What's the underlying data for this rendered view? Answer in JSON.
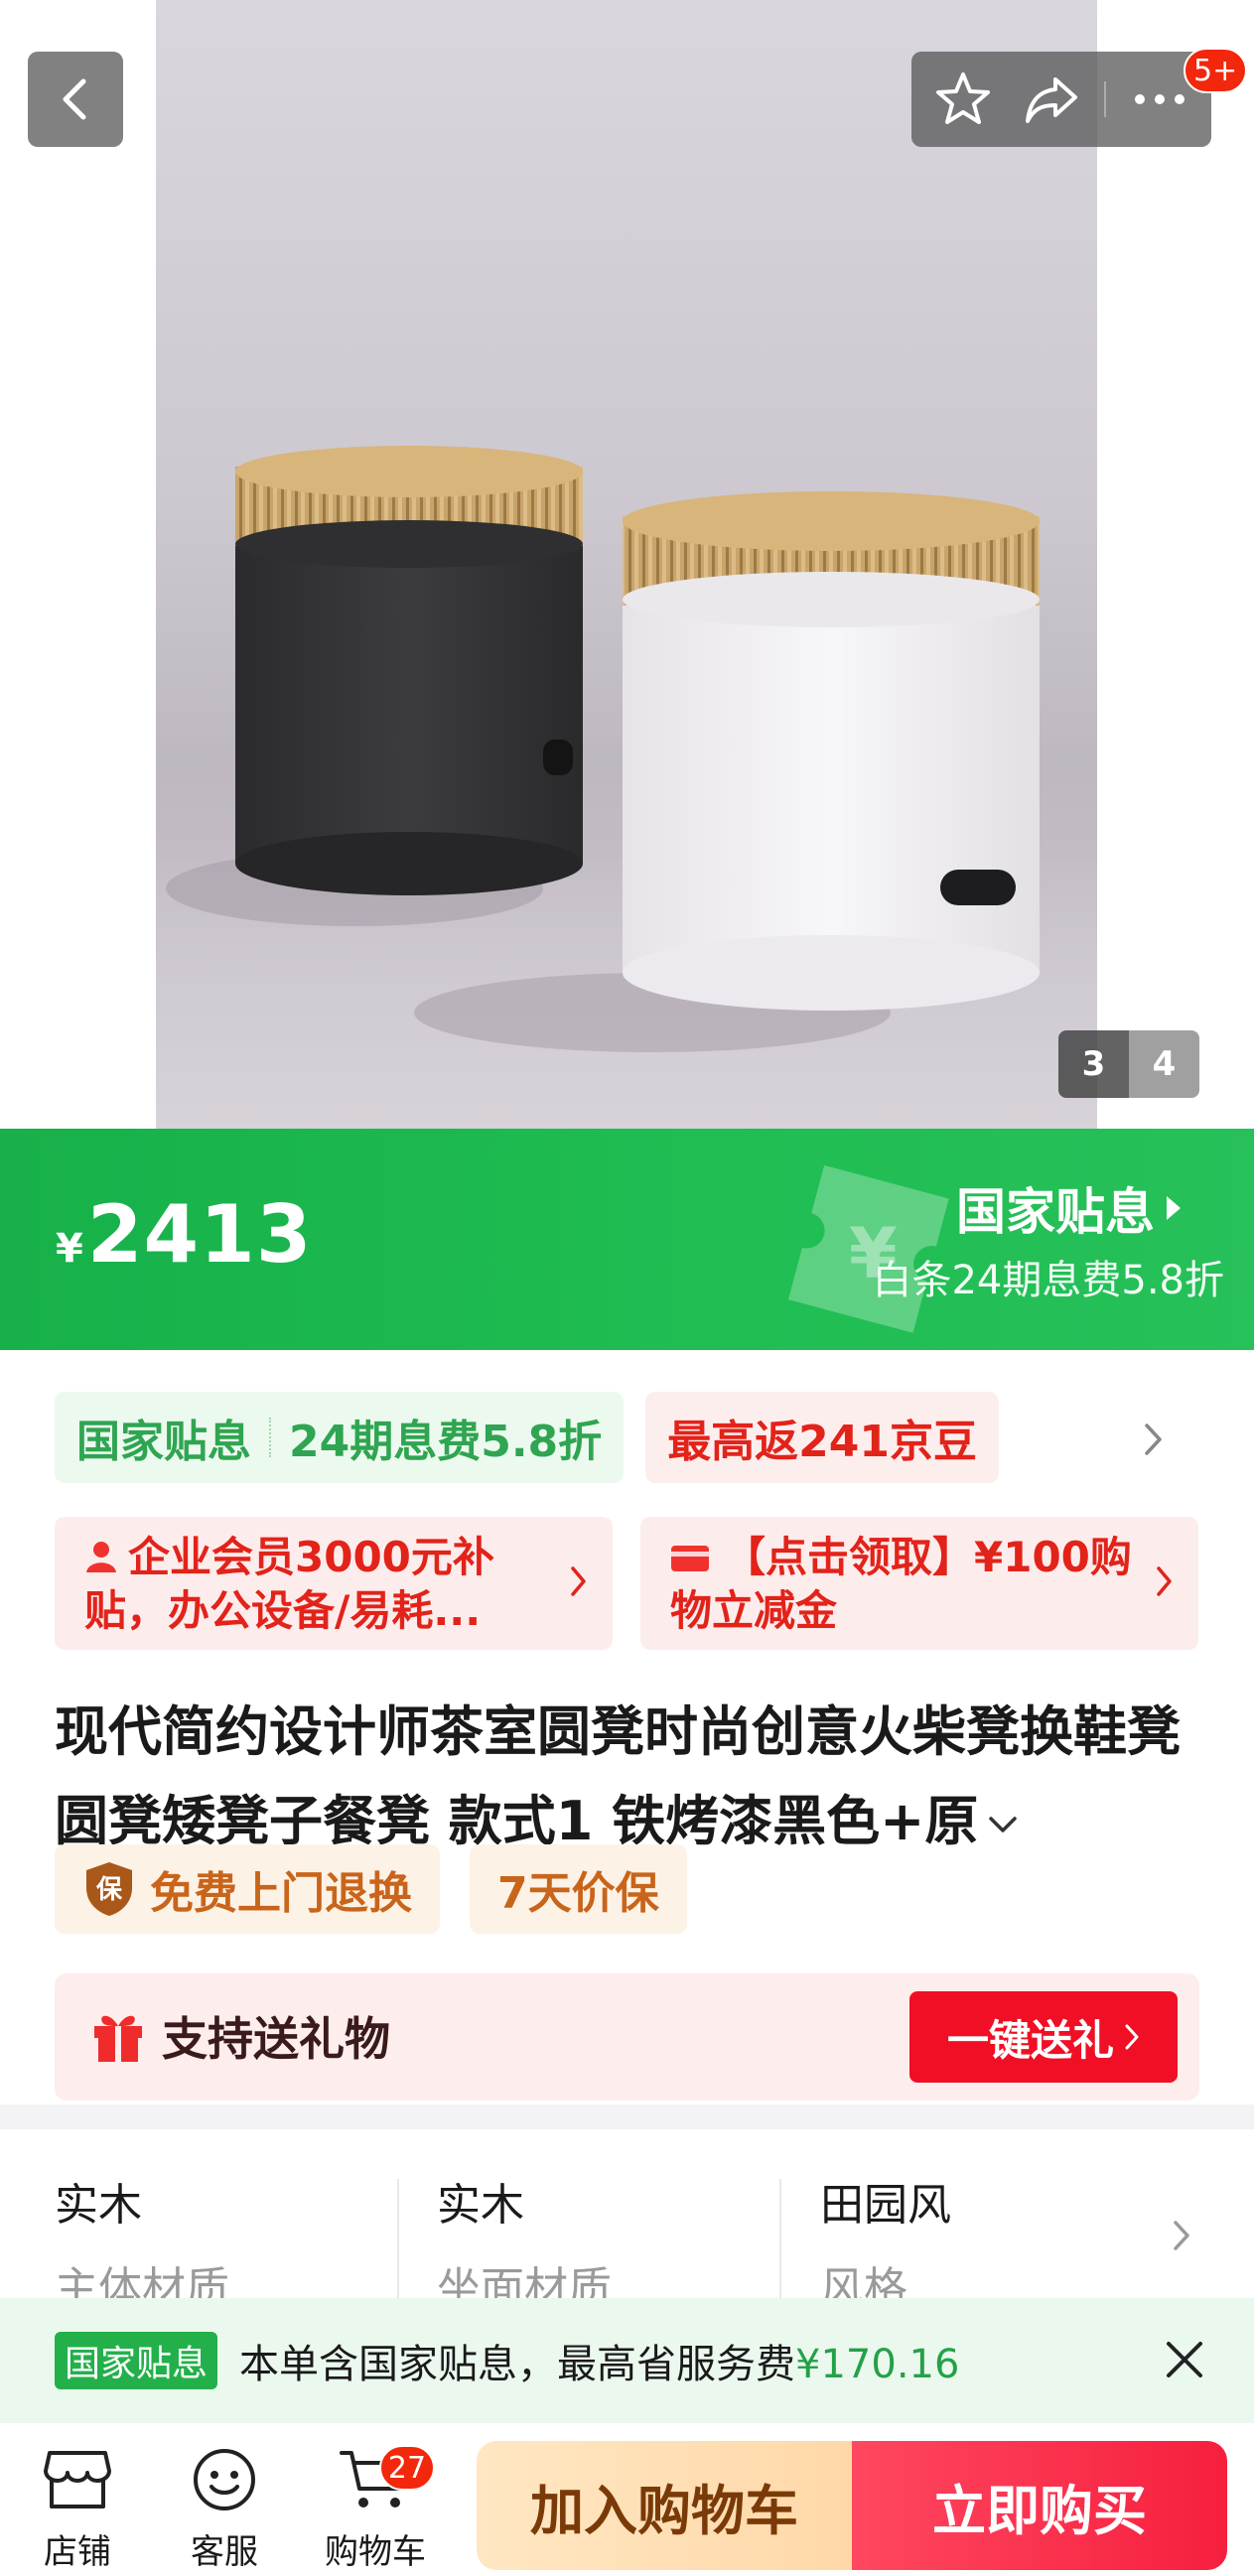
{
  "header": {
    "message_badge": "5+"
  },
  "gallery": {
    "current": "3",
    "total": "4"
  },
  "price_banner": {
    "currency": "¥",
    "price": "2413",
    "subsidy_title": "国家贴息",
    "subsidy_sub": "白条24期息费5.8折"
  },
  "promos": {
    "subsidy_label": "国家贴息",
    "subsidy_detail": "24期息费5.8折",
    "rebate": "最高返241京豆"
  },
  "coupons": [
    {
      "text": "企业会员3000元补贴，办公设备/易耗..."
    },
    {
      "text": "【点击领取】¥100购物立减金"
    }
  ],
  "product": {
    "title": "现代简约设计师茶室圆凳时尚创意火柴凳换鞋凳圆凳矮凳子餐凳 款式1 铁烤漆黑色+原"
  },
  "services": {
    "return_icon": "保",
    "return": "免费上门退换",
    "price_protect": "7天价保"
  },
  "gift": {
    "label": "支持送礼物",
    "button": "一键送礼"
  },
  "specs": [
    {
      "value": "实木",
      "label": "主体材质"
    },
    {
      "value": "实木",
      "label": "坐面材质"
    },
    {
      "value": "田园风",
      "label": "风格"
    }
  ],
  "notice": {
    "badge": "国家贴息",
    "text": "本单含国家贴息，最高省服务费",
    "amount": "¥170.16"
  },
  "bottom_nav": {
    "store": "店铺",
    "service": "客服",
    "cart": "购物车",
    "cart_count": "27",
    "add_to_cart": "加入购物车",
    "buy_now": "立即购买"
  },
  "colors": {
    "accent_green": "#1fbd52",
    "accent_red": "#f00f24",
    "badge_red": "#f2270c"
  },
  "icons": [
    "back-arrow-icon",
    "star-icon",
    "share-icon",
    "more-icon",
    "ticket-icon",
    "user-icon",
    "card-icon",
    "shield-icon",
    "gift-icon",
    "chevron-right-icon",
    "chevron-down-icon",
    "close-icon",
    "store-icon",
    "service-icon",
    "cart-icon"
  ]
}
